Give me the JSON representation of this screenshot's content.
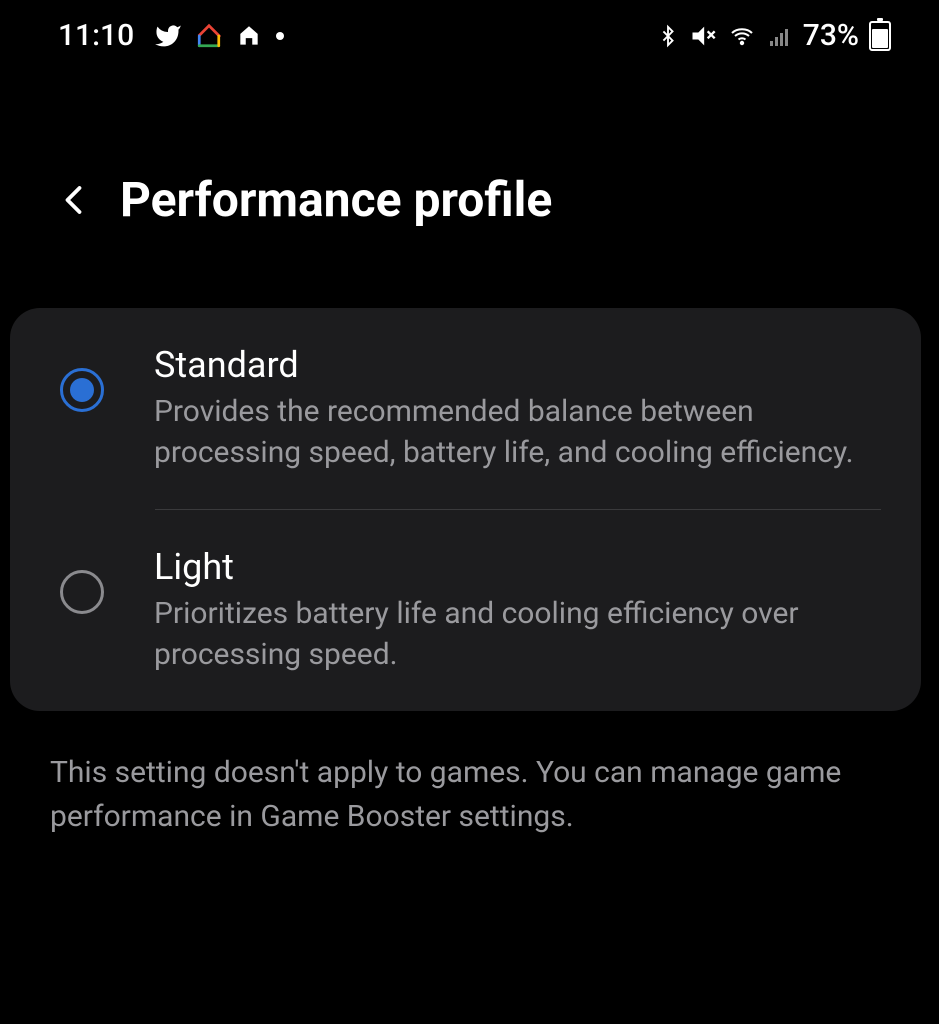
{
  "statusBar": {
    "time": "11:10",
    "batteryPercent": "73%"
  },
  "header": {
    "title": "Performance profile"
  },
  "options": [
    {
      "title": "Standard",
      "description": "Provides the recommended balance between processing speed, battery life, and cooling efficiency.",
      "selected": true
    },
    {
      "title": "Light",
      "description": "Prioritizes battery life and cooling efficiency over processing speed.",
      "selected": false
    }
  ],
  "footerNote": "This setting doesn't apply to games. You can manage game performance in Game Booster settings."
}
